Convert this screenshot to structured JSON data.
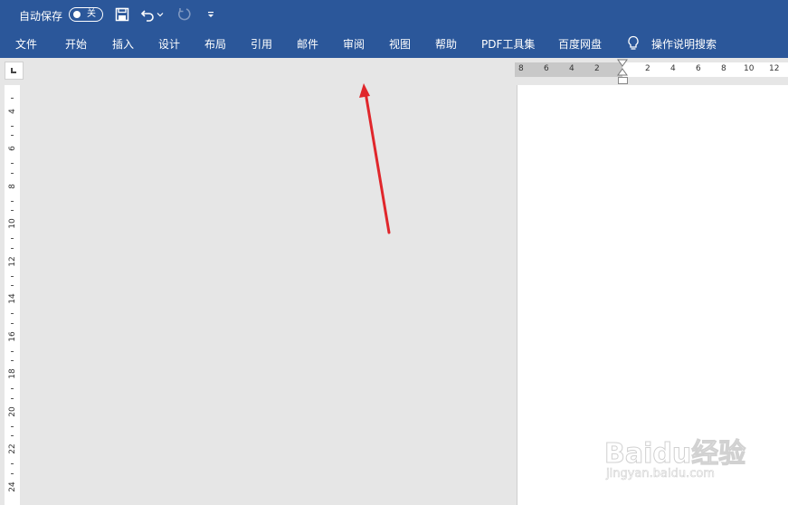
{
  "titlebar": {
    "autosave_label": "自动保存",
    "autosave_state": "关",
    "icons": [
      "save-icon",
      "undo-icon",
      "undo-dropdown-icon",
      "redo-icon",
      "customize-qat-icon"
    ]
  },
  "ribbon": {
    "tabs": [
      {
        "label": "文件"
      },
      {
        "label": "开始"
      },
      {
        "label": "插入"
      },
      {
        "label": "设计"
      },
      {
        "label": "布局"
      },
      {
        "label": "引用"
      },
      {
        "label": "邮件"
      },
      {
        "label": "审阅"
      },
      {
        "label": "视图"
      },
      {
        "label": "帮助"
      },
      {
        "label": "PDF工具集"
      },
      {
        "label": "百度网盘"
      }
    ],
    "search_label": "操作说明搜索",
    "search_icon": "lightbulb-icon"
  },
  "horizontal_ruler": {
    "left_numbers": [
      "8",
      "6",
      "4",
      "2"
    ],
    "right_numbers": [
      "2",
      "4",
      "6",
      "8",
      "10",
      "12"
    ]
  },
  "vertical_ruler": {
    "numbers": [
      "4",
      "6",
      "8",
      "10",
      "12",
      "14",
      "16",
      "18",
      "20",
      "22",
      "24"
    ]
  },
  "annotation": {
    "arrow_color": "#e0262b"
  },
  "watermark": {
    "main": "Baidu经验",
    "sub": "jingyan.baidu.com"
  },
  "colors": {
    "ribbon": "#2b579a",
    "canvas": "#e6e6e6",
    "page": "#ffffff"
  }
}
